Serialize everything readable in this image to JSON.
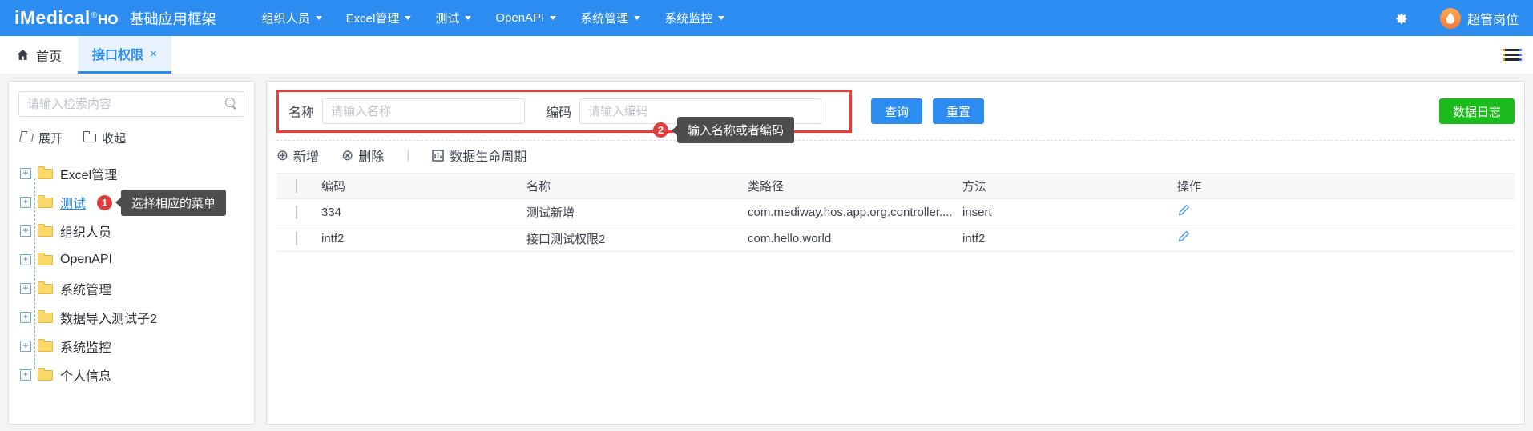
{
  "navbar": {
    "brand": "iMedical",
    "brand_reg": "®",
    "brand_ho": "HO",
    "brand_subtitle": "基础应用框架",
    "menus": [
      {
        "label": "组织人员"
      },
      {
        "label": "Excel管理"
      },
      {
        "label": "测试"
      },
      {
        "label": "OpenAPI"
      },
      {
        "label": "系统管理"
      },
      {
        "label": "系统监控"
      }
    ],
    "role_name": "超管岗位"
  },
  "tabbar": {
    "home_label": "首页",
    "active_tab_label": "接口权限",
    "close_glyph": "×"
  },
  "sidebar": {
    "search_placeholder": "请输入检索内容",
    "expand_label": "展开",
    "collapse_label": "收起",
    "tree": [
      {
        "label": "Excel管理"
      },
      {
        "label": "测试"
      },
      {
        "label": "组织人员"
      },
      {
        "label": "OpenAPI"
      },
      {
        "label": "系统管理"
      },
      {
        "label": "数据导入测试子2"
      },
      {
        "label": "系统监控"
      },
      {
        "label": "个人信息"
      }
    ],
    "annotation": {
      "number": "1",
      "tooltip": "选择相应的菜单"
    }
  },
  "main": {
    "filter": {
      "name_label": "名称",
      "name_placeholder": "请输入名称",
      "code_label": "编码",
      "code_placeholder": "请输入编码"
    },
    "buttons": {
      "query": "查询",
      "reset": "重置",
      "data_log": "数据日志"
    },
    "annotation": {
      "number": "2",
      "tooltip": "输入名称或者编码"
    },
    "toolbar": {
      "add": "新增",
      "delete": "删除",
      "lifecycle": "数据生命周期",
      "add_glyph": "⊕",
      "delete_glyph": "⊗"
    },
    "table": {
      "headers": {
        "code": "编码",
        "name": "名称",
        "classpath": "类路径",
        "method": "方法",
        "action": "操作"
      },
      "rows": [
        {
          "code": "334",
          "name": "测试新增",
          "classpath": "com.mediway.hos.app.org.controller....",
          "method": "insert"
        },
        {
          "code": "intf2",
          "name": "接口测试权限2",
          "classpath": "com.hello.world",
          "method": "intf2"
        }
      ]
    }
  },
  "colors": {
    "primary_blue": "#2d8cf0",
    "success_green": "#1cbb1c",
    "annotation_red": "#e03e3e",
    "folder_yellow": "#fad969",
    "tooltip_gray": "#4d4d4d"
  }
}
